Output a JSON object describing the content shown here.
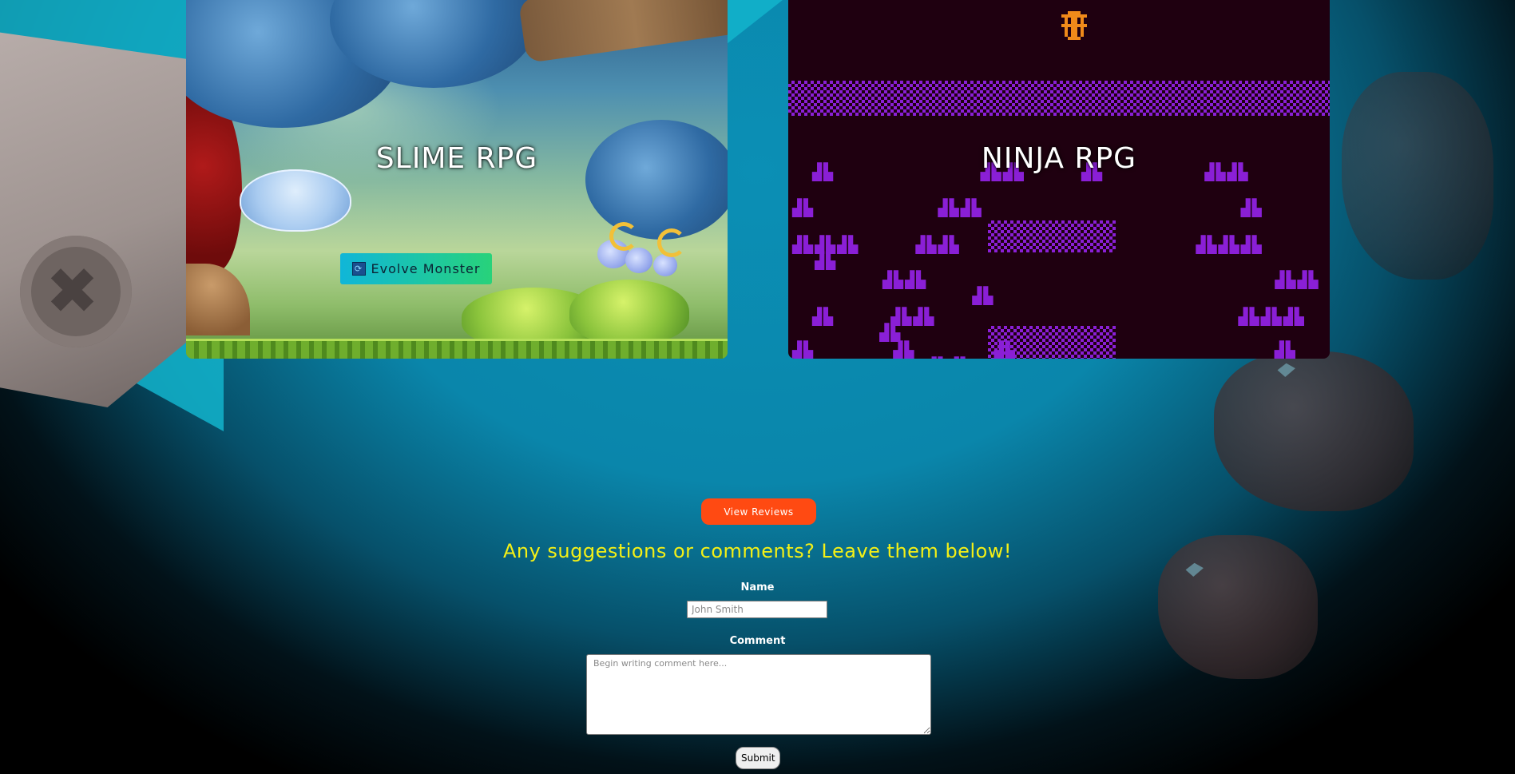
{
  "games": [
    {
      "title": "SLIME RPG",
      "action_button": {
        "label": "Evolve Monster",
        "icon": "evolve-icon"
      }
    },
    {
      "title": "NINJA RPG"
    }
  ],
  "reviews": {
    "button_label": "View Reviews"
  },
  "comment_form": {
    "heading": "Any suggestions or comments? Leave them below!",
    "name_label": "Name",
    "name_placeholder": "John Smith",
    "comment_label": "Comment",
    "comment_placeholder": "Begin writing comment here...",
    "submit_label": "Submit"
  },
  "colors": {
    "background_teal": "#0a86ab",
    "review_button": "#ff4a12",
    "heading_yellow": "#f4f016",
    "ninja_purple": "#8a1fd6",
    "ninja_bg": "#1f0010"
  }
}
